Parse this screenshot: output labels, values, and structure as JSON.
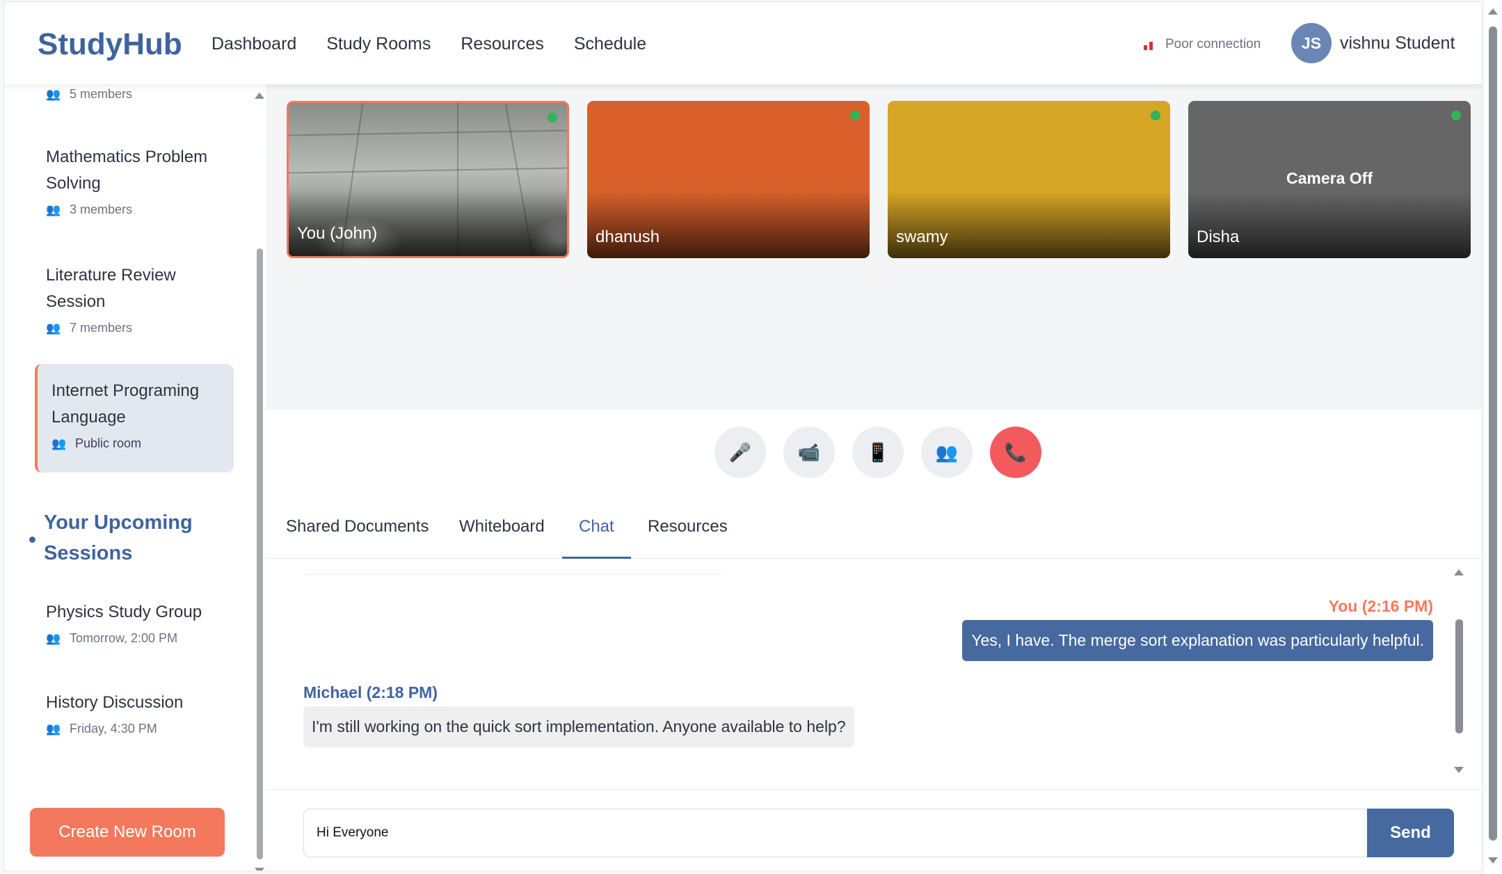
{
  "app": {
    "logo": "StudyHub"
  },
  "nav": [
    {
      "label": "Dashboard"
    },
    {
      "label": "Study Rooms"
    },
    {
      "label": "Resources"
    },
    {
      "label": "Schedule"
    }
  ],
  "connection": {
    "text": "Poor connection",
    "color": "#d9303a"
  },
  "user": {
    "initials": "JS",
    "name": "vishnu Student"
  },
  "sidebar": {
    "partial_room_meta": "5 members",
    "rooms": [
      {
        "title": "Mathematics Problem Solving",
        "meta": "3 members"
      },
      {
        "title": "Literature Review Session",
        "meta": "7 members"
      }
    ],
    "active_room": {
      "title": "Internet Programing Language",
      "meta": "Public room"
    },
    "upcoming_title": "Your Upcoming Sessions",
    "sessions": [
      {
        "title": "Physics Study Group",
        "time": "Tomorrow, 2:00 PM"
      },
      {
        "title": "History Discussion",
        "time": "Friday, 4:30 PM"
      }
    ],
    "create_button": "Create New Room"
  },
  "videos": [
    {
      "name": "You (John)",
      "status": "online"
    },
    {
      "name": "dhanush",
      "color": "#d9602a",
      "status": "online"
    },
    {
      "name": "swamy",
      "color": "#d6a626",
      "status": "online"
    },
    {
      "name": "Disha",
      "color": "#666666",
      "overlay": "Camera Off",
      "status": "online"
    }
  ],
  "controls": [
    {
      "icon": "microphone-icon"
    },
    {
      "icon": "camera-icon"
    },
    {
      "icon": "screen-share-icon"
    },
    {
      "icon": "participants-icon"
    },
    {
      "icon": "end-call-icon"
    }
  ],
  "tabs": [
    {
      "label": "Shared Documents"
    },
    {
      "label": "Whiteboard"
    },
    {
      "label": "Chat",
      "active": true
    },
    {
      "label": "Resources"
    }
  ],
  "chat": {
    "messages": [
      {
        "sender": "You (2:16 PM)",
        "text": "Yes, I have. The merge sort explanation was particularly helpful.",
        "mine": true
      },
      {
        "sender": "Michael (2:18 PM)",
        "text": "I'm still working on the quick sort implementation. Anyone available to help?",
        "mine": false
      }
    ],
    "input_value": "Hi Everyone",
    "send_label": "Send"
  }
}
